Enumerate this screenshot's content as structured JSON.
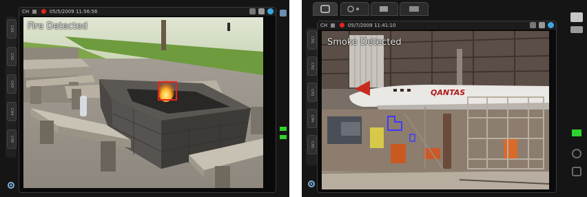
{
  "left": {
    "window": {
      "cam_label": "CH",
      "date": "05/5/2009 11:56:56"
    },
    "overlay": "Fire Detected",
    "channel_tabs": [
      "CH1",
      "CH2",
      "CH3",
      "CH4",
      "CH5"
    ]
  },
  "right": {
    "window": {
      "cam_label": "CH",
      "date": "05/7/2009 11:41:10"
    },
    "overlay": "Smoke Detected",
    "plane_text": "QANTAS",
    "channel_tabs": [
      "CH1",
      "CH2",
      "CH3",
      "CH4",
      "CH5"
    ]
  },
  "colors": {
    "alert_red": "#e5241c",
    "detect_blue": "#3b3bff",
    "status_green": "#2fd12f"
  }
}
